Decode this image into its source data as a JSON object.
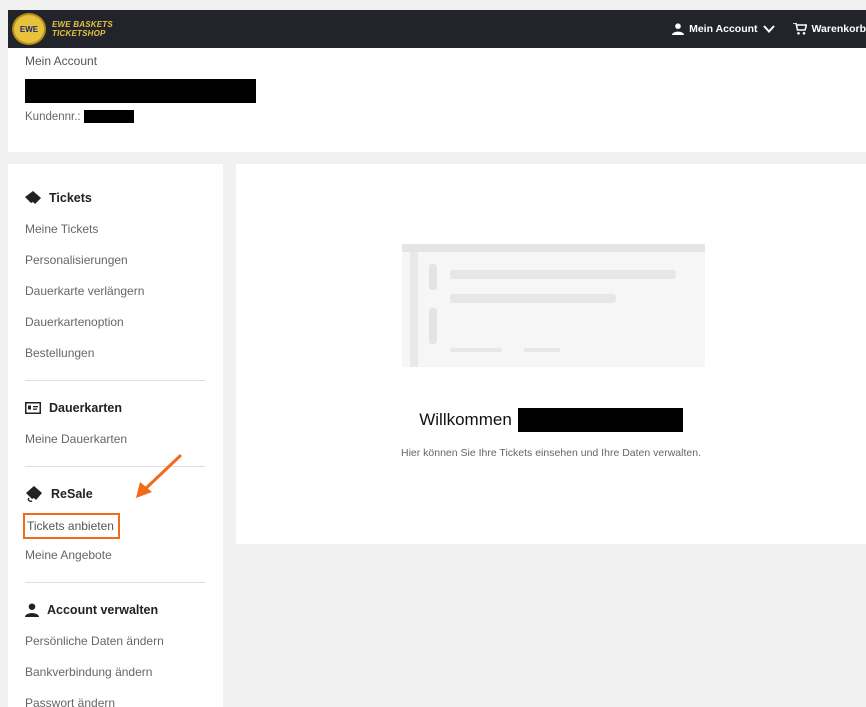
{
  "header": {
    "logo_line1": "EWE BASKETS",
    "logo_line2": "TICKETSHOP",
    "account_label": "Mein Account",
    "cart_label": "Warenkorb"
  },
  "account": {
    "title": "Mein Account",
    "customer_label": "Kundennr.:"
  },
  "sidebar": {
    "tickets": {
      "title": "Tickets",
      "items": [
        "Meine Tickets",
        "Personalisierungen",
        "Dauerkarte verlängern",
        "Dauerkartenoption",
        "Bestellungen"
      ]
    },
    "dauerkarten": {
      "title": "Dauerkarten",
      "items": [
        "Meine Dauerkarten"
      ]
    },
    "resale": {
      "title": "ReSale",
      "items": [
        "Tickets anbieten",
        "Meine Angebote"
      ]
    },
    "account": {
      "title": "Account verwalten",
      "items": [
        "Persönliche Daten ändern",
        "Bankverbindung ändern",
        "Passwort ändern"
      ]
    }
  },
  "main": {
    "welcome": "Willkommen",
    "subtitle": "Hier können Sie Ihre Tickets einsehen und Ihre Daten verwalten."
  },
  "colors": {
    "navbar": "#22242c",
    "highlight": "#f26a1b",
    "brand_yellow": "#e7c23d"
  }
}
